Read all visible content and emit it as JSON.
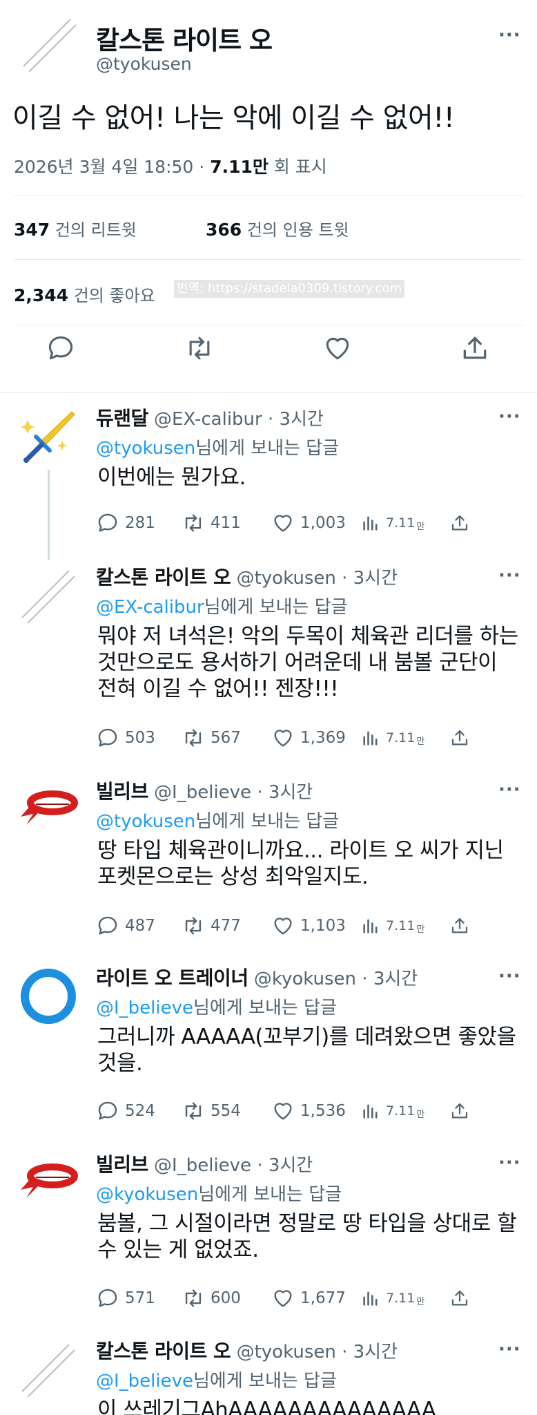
{
  "main_tweet": {
    "author_name": "칼스톤 라이트 오",
    "author_handle": "@tyokusen",
    "text": "이길 수 없어! 나는 악에 이길 수 없어!!",
    "date": "2026년 3월 4일 18:50",
    "dot": "·",
    "views": "7.11만",
    "views_label": "회 표시",
    "retweets": "347",
    "retweets_label": "건의 리트윗",
    "quotes": "366",
    "quotes_label": "건의 인용 트윗",
    "likes": "2,344",
    "likes_label": "건의 좋아요",
    "watermark": "번역: https://stadela0309.tistory.com",
    "more": "···"
  },
  "action_icons": [
    "reply-icon",
    "retweet-icon",
    "like-icon",
    "share-icon"
  ],
  "colors": {
    "accent": "#1d9bf0",
    "secondary_text": "#536471",
    "divider": "#e6e9eb"
  },
  "replies": [
    {
      "name": "듀랜달",
      "handle": "@EX-calibur",
      "dot": "·",
      "time": "3시간",
      "more": "···",
      "mention": "@tyokusen",
      "mention_suffix": "님에게 보내는 답글",
      "text": "이번에는 뭔가요.",
      "reply_count": "281",
      "retweet_count": "411",
      "like_count": "1,003",
      "views": "7.11",
      "views_unit": "만",
      "avatar": "sword-avatar"
    },
    {
      "name": "칼스톤 라이트 오",
      "handle": "@tyokusen",
      "dot": "·",
      "time": "3시간",
      "more": "···",
      "mention": "@EX-calibur",
      "mention_suffix": "님에게 보내는 답글",
      "text": "뭐야 저 녀석은! 악의 두목이 체육관 리더를 하는 것만으로도 용서하기 어려운데 내 붐볼 군단이 전혀 이길 수 없어!! 젠장!!!",
      "reply_count": "503",
      "retweet_count": "567",
      "like_count": "1,369",
      "views": "7.11",
      "views_unit": "만",
      "avatar": "slash-avatar"
    },
    {
      "name": "빌리브",
      "handle": "@I_believe",
      "dot": "·",
      "time": "3시간",
      "more": "···",
      "mention": "@tyokusen",
      "mention_suffix": "님에게 보내는 답글",
      "text": "땅 타입 체육관이니까요... 라이트 오 씨가 지닌 포켓몬으로는 상성 최악일지도.",
      "reply_count": "487",
      "retweet_count": "477",
      "like_count": "1,103",
      "views": "7.11",
      "views_unit": "만",
      "avatar": "headband-avatar"
    },
    {
      "name": "라이트 오 트레이너",
      "handle": "@kyokusen",
      "dot": "·",
      "time": "3시간",
      "more": "···",
      "mention": "@I_believe",
      "mention_suffix": "님에게 보내는 답글",
      "text": "그러니까 AAAAA(꼬부기)를 데려왔으면 좋았을 것을.",
      "reply_count": "524",
      "retweet_count": "554",
      "like_count": "1,536",
      "views": "7.11",
      "views_unit": "만",
      "avatar": "ring-avatar"
    },
    {
      "name": "빌리브",
      "handle": "@I_believe",
      "dot": "·",
      "time": "3시간",
      "more": "···",
      "mention": "@kyokusen",
      "mention_suffix": "님에게 보내는 답글",
      "text": "붐볼, 그 시절이라면 정말로 땅 타입을 상대로 할 수 있는 게 없었죠.",
      "reply_count": "571",
      "retweet_count": "600",
      "like_count": "1,677",
      "views": "7.11",
      "views_unit": "만",
      "avatar": "headband-avatar"
    },
    {
      "name": "칼스톤 라이트 오",
      "handle": "@tyokusen",
      "dot": "·",
      "time": "3시간",
      "more": "···",
      "mention": "@I_believe",
      "mention_suffix": "님에게 보내는 답글",
      "text": "이 쓰레기그AhAAAAAAAAAAAAAA",
      "avatar": "slash-avatar"
    }
  ]
}
